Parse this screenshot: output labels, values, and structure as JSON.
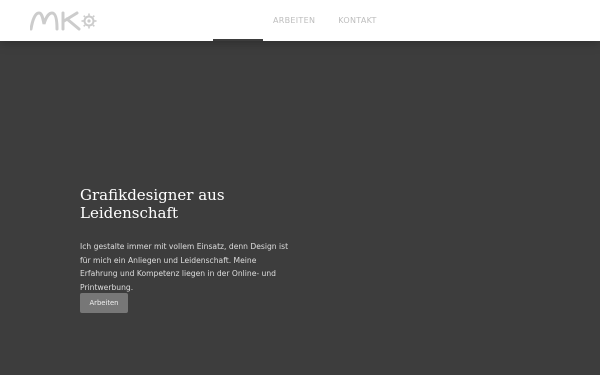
{
  "brand": {
    "logo_text": "MK",
    "accent": "#cccccc"
  },
  "nav": {
    "items": [
      {
        "label": "ARBEITEN"
      },
      {
        "label": "KONTAKT"
      }
    ]
  },
  "hero": {
    "title": "Grafikdesigner aus Leidenschaft",
    "text": "Ich gestalte immer mit vollem Einsatz, denn Design ist für mich ein Anliegen und Leidenschaft. Meine Erfahrung und Kompetenz liegen in der Online- und Printwerbung.",
    "button_label": "Arbeiten"
  },
  "colors": {
    "background": "#3d3d3d",
    "navbar": "#ffffff",
    "button": "#777777"
  }
}
